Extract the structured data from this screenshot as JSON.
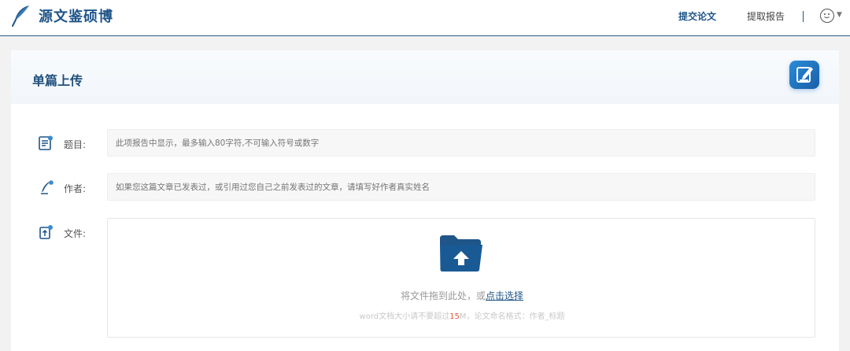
{
  "header": {
    "brand": "源文鉴硕博",
    "nav": [
      {
        "label": "提交论文",
        "active": true
      },
      {
        "label": "提取报告",
        "active": false
      }
    ]
  },
  "card": {
    "title": "单篇上传",
    "fields": {
      "title_label": "题目:",
      "title_placeholder": "此项报告中显示，最多输入80字符,不可输入符号或数字",
      "author_label": "作者:",
      "author_placeholder": "如果您这篇文章已发表过，或引用过您自己之前发表过的文章，请填写好作者真实姓名",
      "file_label": "文件:"
    },
    "dropzone": {
      "text_prefix": "将文件拖到此处，或",
      "text_link": "点击选择",
      "hint_prefix": "word文档大小请不要超过",
      "hint_size": "15",
      "hint_suffix": "M，论文命名格式：作者_标题"
    }
  },
  "colors": {
    "brand": "#1f5589",
    "highlight": "#e05a3a"
  },
  "icons": [
    "feather-logo-icon",
    "avatar-icon",
    "edit-icon",
    "title-doc-icon",
    "author-pen-icon",
    "file-upload-icon",
    "folder-upload-icon"
  ]
}
